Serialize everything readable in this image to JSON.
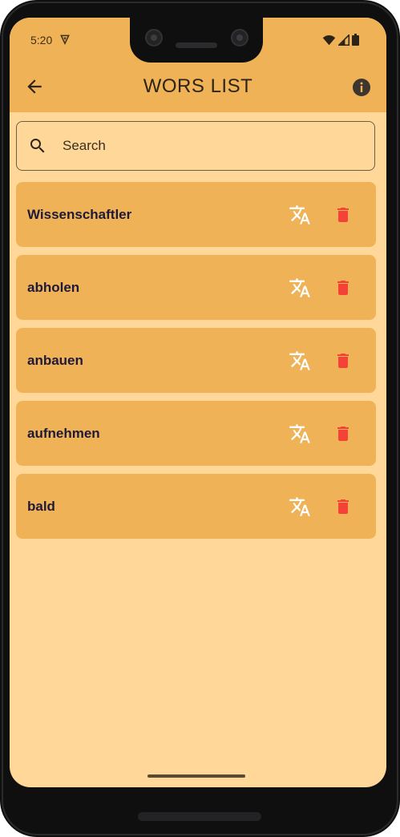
{
  "status_bar": {
    "time": "5:20"
  },
  "app_bar": {
    "title": "WORS LIST"
  },
  "search": {
    "placeholder": "Search",
    "value": ""
  },
  "words": [
    {
      "word": "Wissenschaftler"
    },
    {
      "word": "abholen"
    },
    {
      "word": "anbauen"
    },
    {
      "word": "aufnehmen"
    },
    {
      "word": "bald"
    }
  ],
  "colors": {
    "background": "#FFD899",
    "app_bar": "#EFB256",
    "card": "#EFB256",
    "delete_icon": "#F44336",
    "translate_icon": "#FFFFFF",
    "text": "#1E1A3A"
  },
  "icons": {
    "back": "arrow-back-icon",
    "info": "info-icon",
    "search": "search-icon",
    "translate": "translate-icon",
    "delete": "trash-icon"
  }
}
